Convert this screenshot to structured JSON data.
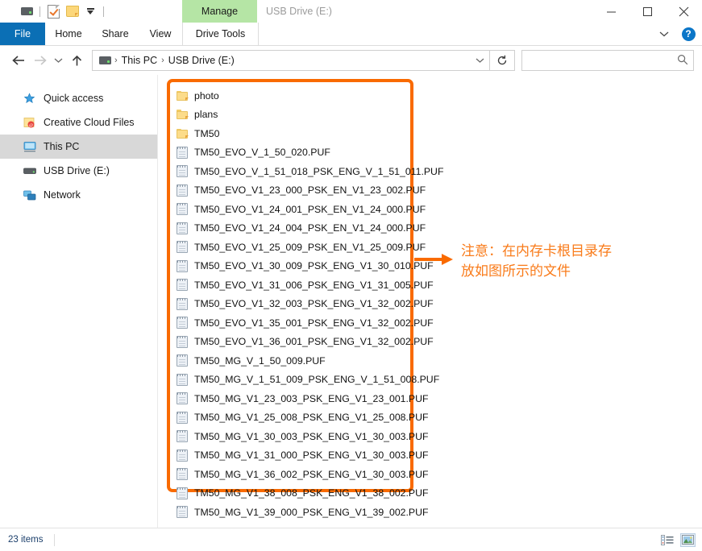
{
  "titlebar": {
    "quick_access": [
      {
        "name": "drive-icon",
        "label": "Drive"
      },
      {
        "name": "properties-icon",
        "label": "Properties"
      },
      {
        "name": "new-folder-icon",
        "label": "New folder"
      },
      {
        "name": "customize-dropdown-icon",
        "label": "Customize Quick Access Toolbar"
      }
    ],
    "contextual_tab": "Manage",
    "window_title": "USB Drive (E:)",
    "minimize": "─",
    "maximize": "□",
    "close": "✕"
  },
  "ribbon": {
    "tabs": [
      {
        "label": "File",
        "active": true
      },
      {
        "label": "Home",
        "active": false
      },
      {
        "label": "Share",
        "active": false
      },
      {
        "label": "View",
        "active": false
      },
      {
        "label": "Drive Tools",
        "active": false
      }
    ],
    "collapse_label": "ˇ",
    "help_label": "?"
  },
  "address": {
    "back_label": "Back",
    "forward_label": "Forward",
    "recent_label": "Recent locations",
    "up_label": "Up",
    "breadcrumbs": [
      "This PC",
      "USB Drive (E:)"
    ],
    "separator": "›",
    "dropdown_label": "ˇ",
    "refresh_label": "↻"
  },
  "search": {
    "value": "",
    "placeholder": "",
    "icon": "search-icon"
  },
  "sidebar": {
    "items": [
      {
        "label": "Quick access",
        "icon": "star-icon",
        "selected": false
      },
      {
        "label": "Creative Cloud Files",
        "icon": "creative-cloud-icon",
        "selected": false
      },
      {
        "label": "This PC",
        "icon": "computer-icon",
        "selected": true
      },
      {
        "label": "USB Drive (E:)",
        "icon": "drive-icon",
        "selected": false
      },
      {
        "label": "Network",
        "icon": "network-icon",
        "selected": false
      }
    ]
  },
  "files": [
    {
      "name": "photo",
      "type": "folder"
    },
    {
      "name": "plans",
      "type": "folder"
    },
    {
      "name": "TM50",
      "type": "folder"
    },
    {
      "name": "TM50_EVO_V_1_50_020.PUF",
      "type": "puf"
    },
    {
      "name": "TM50_EVO_V_1_51_018_PSK_ENG_V_1_51_011.PUF",
      "type": "puf"
    },
    {
      "name": "TM50_EVO_V1_23_000_PSK_EN_V1_23_002.PUF",
      "type": "puf"
    },
    {
      "name": "TM50_EVO_V1_24_001_PSK_EN_V1_24_000.PUF",
      "type": "puf"
    },
    {
      "name": "TM50_EVO_V1_24_004_PSK_EN_V1_24_000.PUF",
      "type": "puf"
    },
    {
      "name": "TM50_EVO_V1_25_009_PSK_EN_V1_25_009.PUF",
      "type": "puf"
    },
    {
      "name": "TM50_EVO_V1_30_009_PSK_ENG_V1_30_010.PUF",
      "type": "puf"
    },
    {
      "name": "TM50_EVO_V1_31_006_PSK_ENG_V1_31_005.PUF",
      "type": "puf"
    },
    {
      "name": "TM50_EVO_V1_32_003_PSK_ENG_V1_32_002.PUF",
      "type": "puf"
    },
    {
      "name": "TM50_EVO_V1_35_001_PSK_ENG_V1_32_002.PUF",
      "type": "puf"
    },
    {
      "name": "TM50_EVO_V1_36_001_PSK_ENG_V1_32_002.PUF",
      "type": "puf"
    },
    {
      "name": "TM50_MG_V_1_50_009.PUF",
      "type": "puf"
    },
    {
      "name": "TM50_MG_V_1_51_009_PSK_ENG_V_1_51_008.PUF",
      "type": "puf"
    },
    {
      "name": "TM50_MG_V1_23_003_PSK_ENG_V1_23_001.PUF",
      "type": "puf"
    },
    {
      "name": "TM50_MG_V1_25_008_PSK_ENG_V1_25_008.PUF",
      "type": "puf"
    },
    {
      "name": "TM50_MG_V1_30_003_PSK_ENG_V1_30_003.PUF",
      "type": "puf"
    },
    {
      "name": "TM50_MG_V1_31_000_PSK_ENG_V1_30_003.PUF",
      "type": "puf"
    },
    {
      "name": "TM50_MG_V1_36_002_PSK_ENG_V1_30_003.PUF",
      "type": "puf"
    },
    {
      "name": "TM50_MG_V1_38_008_PSK_ENG_V1_38_002.PUF",
      "type": "puf"
    },
    {
      "name": "TM50_MG_V1_39_000_PSK_ENG_V1_39_002.PUF",
      "type": "puf"
    }
  ],
  "annotation": {
    "text": "注意：在内存卡根目录存\n放如图所示的文件",
    "color": "#f97b1a",
    "highlight_color": "#f96a00"
  },
  "status": {
    "items_text": "23 items",
    "view_details": "details-view-icon",
    "view_thumbnails": "thumbnail-view-icon"
  }
}
